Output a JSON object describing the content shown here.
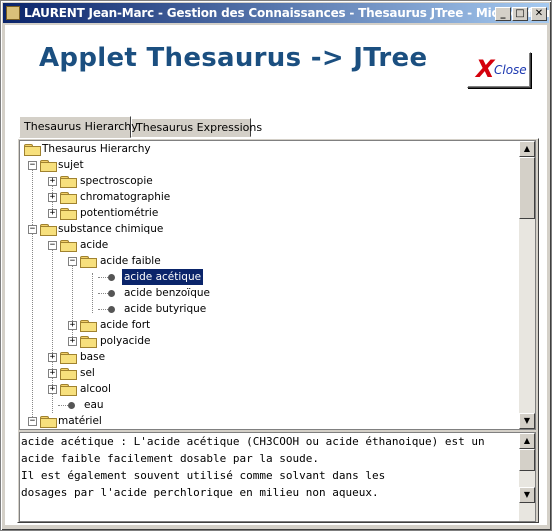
{
  "window": {
    "title": "LAURENT Jean-Marc - Gestion des Connaissances - Thesaurus JTree - Microsoft In...",
    "buttons": {
      "minimize": "_",
      "maximize": "□",
      "close": "✕"
    }
  },
  "applet": {
    "title": "Applet Thesaurus -> JTree",
    "close_icon": "X",
    "close_label": "Close"
  },
  "tabs": [
    {
      "label": "Thesaurus Hierarchy",
      "active": true
    },
    {
      "label": "Thesaurus Expressions",
      "active": false
    }
  ],
  "tree": {
    "nodes": [
      {
        "label": "Thesaurus Hierarchy"
      },
      {
        "label": "sujet"
      },
      {
        "label": "spectroscopie"
      },
      {
        "label": "chromatographie"
      },
      {
        "label": "potentiométrie"
      },
      {
        "label": "substance chimique"
      },
      {
        "label": "acide"
      },
      {
        "label": "acide faible"
      },
      {
        "label": "acide acétique",
        "selected": true
      },
      {
        "label": "acide benzoïque"
      },
      {
        "label": "acide butyrique"
      },
      {
        "label": "acide fort"
      },
      {
        "label": "polyacide"
      },
      {
        "label": "base"
      },
      {
        "label": "sel"
      },
      {
        "label": "alcool"
      },
      {
        "label": "eau"
      },
      {
        "label": "matériel"
      }
    ]
  },
  "description": {
    "lines": [
      "acide acétique : L'acide acétique (CH3COOH ou acide éthanoique) est un",
      "acide faible facilement dosable par la soude.",
      "Il est également souvent utilisé comme solvant dans les",
      "dosages par l'acide perchlorique en milieu non aqueux."
    ]
  },
  "scroll": {
    "up": "▲",
    "down": "▼"
  },
  "colors": {
    "title_text": "#1b4f80",
    "selection": "#0a246a",
    "titlebar": "#0a246a"
  }
}
